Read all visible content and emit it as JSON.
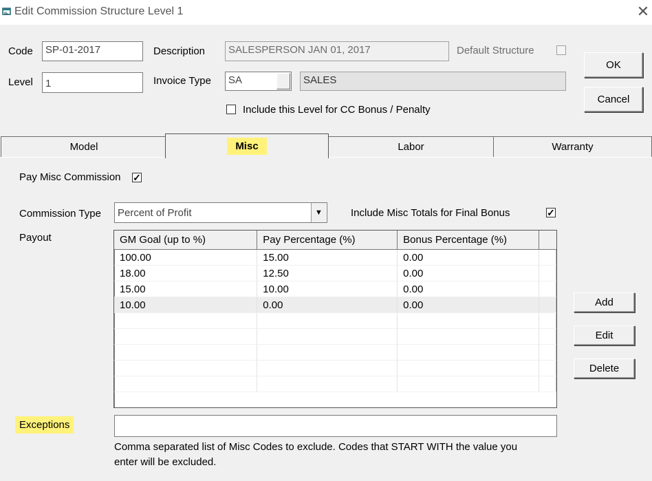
{
  "window": {
    "title": "Edit Commission Structure Level  1",
    "icon": "app-icon",
    "close_glyph": "✕"
  },
  "header": {
    "code_label": "Code",
    "code_value": "SP-01-2017",
    "level_label": "Level",
    "level_value": "1",
    "description_label": "Description",
    "description_value": "SALESPERSON JAN 01, 2017",
    "default_structure_label": "Default Structure",
    "default_structure_checked": false,
    "invoice_type_label": "Invoice Type",
    "invoice_type_code": "SA",
    "invoice_type_name": "SALES",
    "cc_bonus_label": "Include this Level for CC Bonus / Penalty",
    "cc_bonus_checked": false
  },
  "buttons": {
    "ok": "OK",
    "cancel": "Cancel",
    "add": "Add",
    "edit": "Edit",
    "delete": "Delete"
  },
  "tabs": [
    {
      "label": "Model",
      "active": false
    },
    {
      "label": "Misc",
      "active": true
    },
    {
      "label": "Labor",
      "active": false
    },
    {
      "label": "Warranty",
      "active": false
    }
  ],
  "misc": {
    "pay_misc_label": "Pay Misc Commission",
    "pay_misc_checked": true,
    "commission_type_label": "Commission Type",
    "commission_type_value": "Percent of Profit",
    "include_totals_label": "Include Misc Totals for Final Bonus",
    "include_totals_checked": true,
    "payout_label": "Payout",
    "columns": [
      "GM Goal (up to %)",
      "Pay Percentage (%)",
      "Bonus Percentage (%)"
    ],
    "rows": [
      [
        "100.00",
        "15.00",
        "0.00"
      ],
      [
        "18.00",
        "12.50",
        "0.00"
      ],
      [
        "15.00",
        "10.00",
        "0.00"
      ],
      [
        "10.00",
        "0.00",
        "0.00"
      ]
    ],
    "exceptions_label": "Exceptions",
    "exceptions_value": "",
    "exceptions_note_line1": "Comma separated list of Misc Codes to exclude.  Codes that START WITH the value you",
    "exceptions_note_line2": "enter will be excluded."
  },
  "colors": {
    "highlight": "#fff27a",
    "window_bg": "#f0f0f0"
  }
}
